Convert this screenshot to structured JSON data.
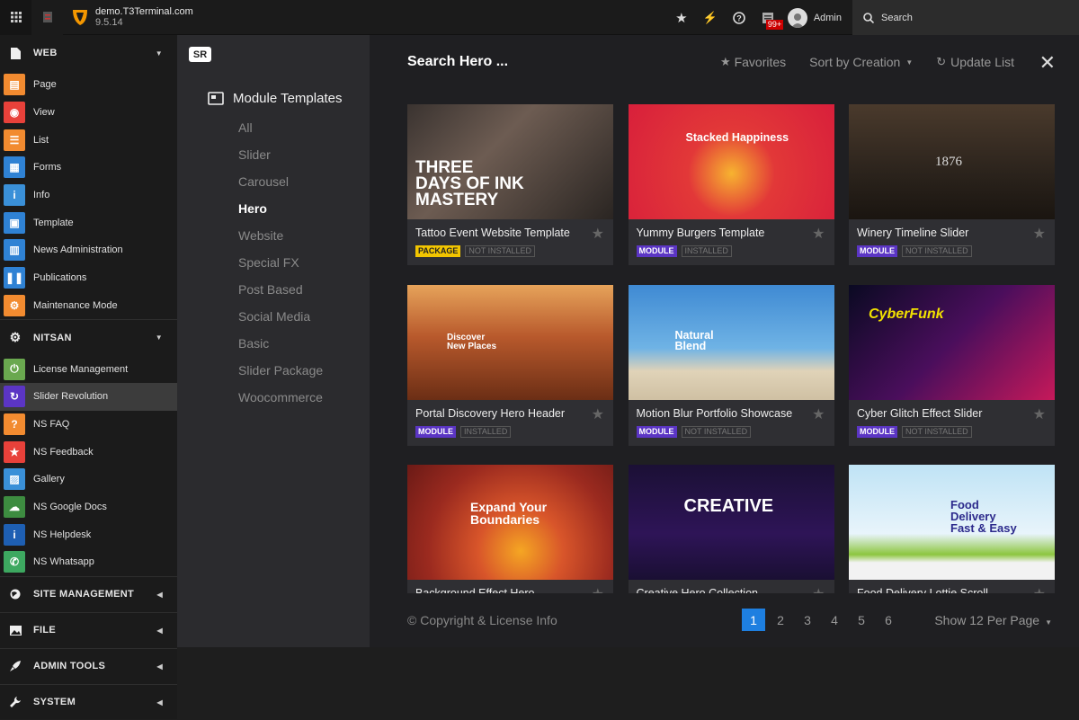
{
  "topbar": {
    "site": "demo.T3Terminal.com",
    "version": "9.5.14",
    "badge": "99+",
    "user": "Admin",
    "search_label": "Search"
  },
  "sidebar": {
    "groups": [
      {
        "label": "WEB",
        "expanded": true
      },
      {
        "label": "NITSAN",
        "expanded": true
      },
      {
        "label": "SITE MANAGEMENT",
        "expanded": false
      },
      {
        "label": "FILE",
        "expanded": false
      },
      {
        "label": "ADMIN TOOLS",
        "expanded": false
      },
      {
        "label": "SYSTEM",
        "expanded": false
      }
    ],
    "web_items": [
      {
        "label": "Page",
        "icon": "page-icon",
        "color": "#f28b30"
      },
      {
        "label": "View",
        "icon": "eye-icon",
        "color": "#e8413a"
      },
      {
        "label": "List",
        "icon": "list-icon",
        "color": "#f28b30"
      },
      {
        "label": "Forms",
        "icon": "forms-icon",
        "color": "#2f82d4"
      },
      {
        "label": "Info",
        "icon": "info-icon",
        "color": "#3a90d8"
      },
      {
        "label": "Template",
        "icon": "template-icon",
        "color": "#2f82d4"
      },
      {
        "label": "News Administration",
        "icon": "news-icon",
        "color": "#2f82d4"
      },
      {
        "label": "Publications",
        "icon": "book-icon",
        "color": "#2f82d4"
      },
      {
        "label": "Maintenance Mode",
        "icon": "gear-icon",
        "color": "#f28b30"
      }
    ],
    "nitsan_items": [
      {
        "label": "License Management",
        "icon": "power-icon",
        "color": "#6aa84f"
      },
      {
        "label": "Slider Revolution",
        "icon": "refresh-icon",
        "color": "#5b35c4",
        "active": true
      },
      {
        "label": "NS FAQ",
        "icon": "faq-icon",
        "color": "#f28b30"
      },
      {
        "label": "NS Feedback",
        "icon": "star-icon",
        "color": "#e8413a"
      },
      {
        "label": "Gallery",
        "icon": "gallery-icon",
        "color": "#3a90d8"
      },
      {
        "label": "NS Google Docs",
        "icon": "cloud-icon",
        "color": "#3d8c40"
      },
      {
        "label": "NS Helpdesk",
        "icon": "info-icon",
        "color": "#1e5fb3"
      },
      {
        "label": "NS Whatsapp",
        "icon": "whatsapp-icon",
        "color": "#3da860"
      }
    ]
  },
  "sr_panel": {
    "logo": "SR",
    "heading": "Module Templates",
    "categories": [
      "All",
      "Slider",
      "Carousel",
      "Hero",
      "Website",
      "Special FX",
      "Post Based",
      "Social Media",
      "Basic",
      "Slider Package",
      "Woocommerce"
    ],
    "selected": "Hero"
  },
  "main": {
    "title": "Search Hero ...",
    "favorites": "Favorites",
    "sort": "Sort by Creation",
    "update": "Update List",
    "footer": "© Copyright & License Info",
    "pages": [
      "1",
      "2",
      "3",
      "4",
      "5",
      "6"
    ],
    "current_page": "1",
    "per_page": "Show 12 Per Page",
    "cards": [
      {
        "name": "Tattoo Event Website Template",
        "type": "PACKAGE",
        "status": "NOT INSTALLED",
        "thumb_text": "THREE\nDAYS OF INK\nMASTERY"
      },
      {
        "name": "Yummy Burgers Template",
        "type": "MODULE",
        "status": "INSTALLED",
        "thumb_text": "Stacked Happiness"
      },
      {
        "name": "Winery Timeline Slider",
        "type": "MODULE",
        "status": "NOT INSTALLED",
        "thumb_text": "1876"
      },
      {
        "name": "Portal Discovery Hero Header",
        "type": "MODULE",
        "status": "INSTALLED",
        "thumb_text": "Discover\nNew Places"
      },
      {
        "name": "Motion Blur Portfolio Showcase",
        "type": "MODULE",
        "status": "NOT INSTALLED",
        "thumb_text": "Natural\nBlend"
      },
      {
        "name": "Cyber Glitch Effect Slider",
        "type": "MODULE",
        "status": "NOT INSTALLED",
        "thumb_text": "CyberFunk"
      },
      {
        "name": "Background Effect Hero",
        "type": "",
        "status": "",
        "thumb_text": "Expand Your\nBoundaries"
      },
      {
        "name": "Creative Hero Collection",
        "type": "",
        "status": "",
        "thumb_text": "CREATIVE"
      },
      {
        "name": "Food Delivery Lottie Scroll",
        "type": "",
        "status": "",
        "thumb_text": "Food\nDelivery\nFast & Easy"
      }
    ]
  }
}
